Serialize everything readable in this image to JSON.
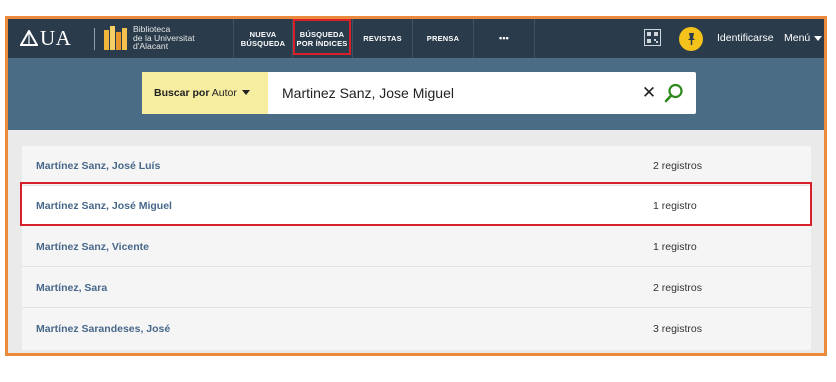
{
  "colors": {
    "topbar": "#2a3b4b",
    "search_band": "#4b6c85",
    "selector_bg": "#f6eda0",
    "accent_pin": "#f4c21b",
    "frame_border": "#ea8a3a",
    "highlight": "#d6202a",
    "link": "#47688a"
  },
  "header": {
    "logo": "UA",
    "library_lines": [
      "Biblioteca",
      "de la Universitat",
      "d'Alacant"
    ],
    "nav": [
      {
        "lines": [
          "NUEVA",
          "BÚSQUEDA"
        ]
      },
      {
        "lines": [
          "BÚSQUEDA",
          "POR ÍNDICES"
        ]
      },
      {
        "lines": [
          "REVISTAS"
        ]
      },
      {
        "lines": [
          "PRENSA"
        ]
      },
      {
        "lines": [
          "•••"
        ]
      }
    ],
    "icons": [
      "qr-code-icon",
      "pin-icon"
    ],
    "login": "Identificarse",
    "menu": "Menú"
  },
  "search": {
    "selector_bold": "Buscar por",
    "selector_value": "Autor",
    "query": "Martinez Sanz, Jose Miguel",
    "clear_glyph": "✕"
  },
  "results": [
    {
      "name": "Martínez Sanz, José Luís",
      "count": "2 registros"
    },
    {
      "name": "Martínez Sanz, José Miguel",
      "count": "1 registro"
    },
    {
      "name": "Martínez Sanz, Vicente",
      "count": "1 registro"
    },
    {
      "name": "Martínez, Sara",
      "count": "2 registros"
    },
    {
      "name": "Martínez Sarandeses, José",
      "count": "3 registros"
    }
  ]
}
